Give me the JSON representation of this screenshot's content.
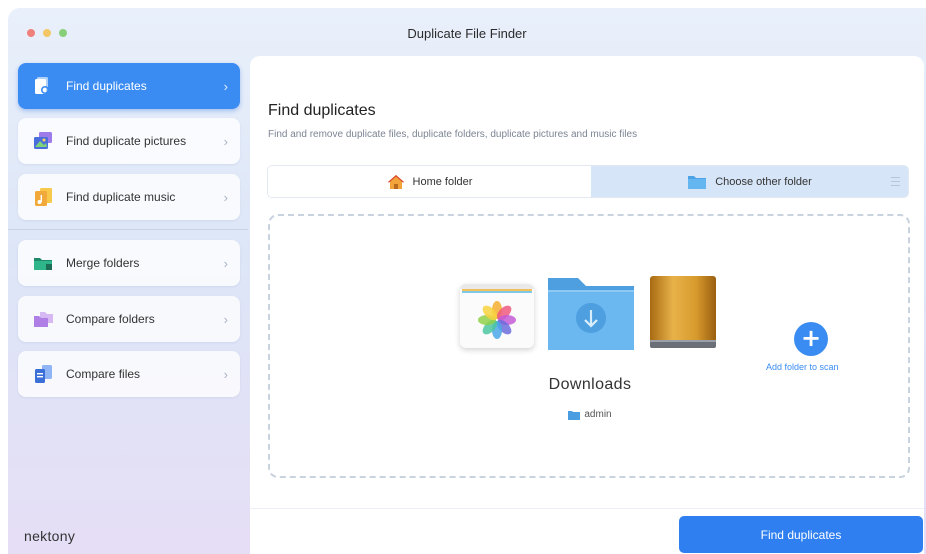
{
  "window": {
    "title": "Duplicate File Finder"
  },
  "sidebar": {
    "items": [
      {
        "label": "Find duplicates",
        "icon": "find-duplicates-icon",
        "chevron": "›",
        "active": true
      },
      {
        "label": "Find duplicate pictures",
        "icon": "pictures-icon",
        "chevron": "›"
      },
      {
        "label": "Find duplicate music",
        "icon": "music-icon",
        "chevron": "›"
      },
      {
        "label": "Merge folders",
        "icon": "merge-folders-icon",
        "chevron": "›"
      },
      {
        "label": "Compare folders",
        "icon": "compare-folders-icon",
        "chevron": "›"
      },
      {
        "label": "Compare files",
        "icon": "compare-files-icon",
        "chevron": "›"
      }
    ],
    "brand": "nektony"
  },
  "main": {
    "title": "Find duplicates",
    "subtitle": "Find and remove duplicate files, duplicate folders, duplicate pictures and music files",
    "segments": {
      "home": "Home folder",
      "other": "Choose other folder",
      "selected": "other"
    },
    "dropzone": {
      "folder_name": "Downloads",
      "folder_path": "admin",
      "add_label": "Add folder to scan",
      "add_symbol": "+"
    },
    "primary_button": "Find duplicates"
  },
  "colors": {
    "accent": "#3a8cf2",
    "button": "#2f7ff0",
    "segment_selected": "#d6e6f8"
  }
}
